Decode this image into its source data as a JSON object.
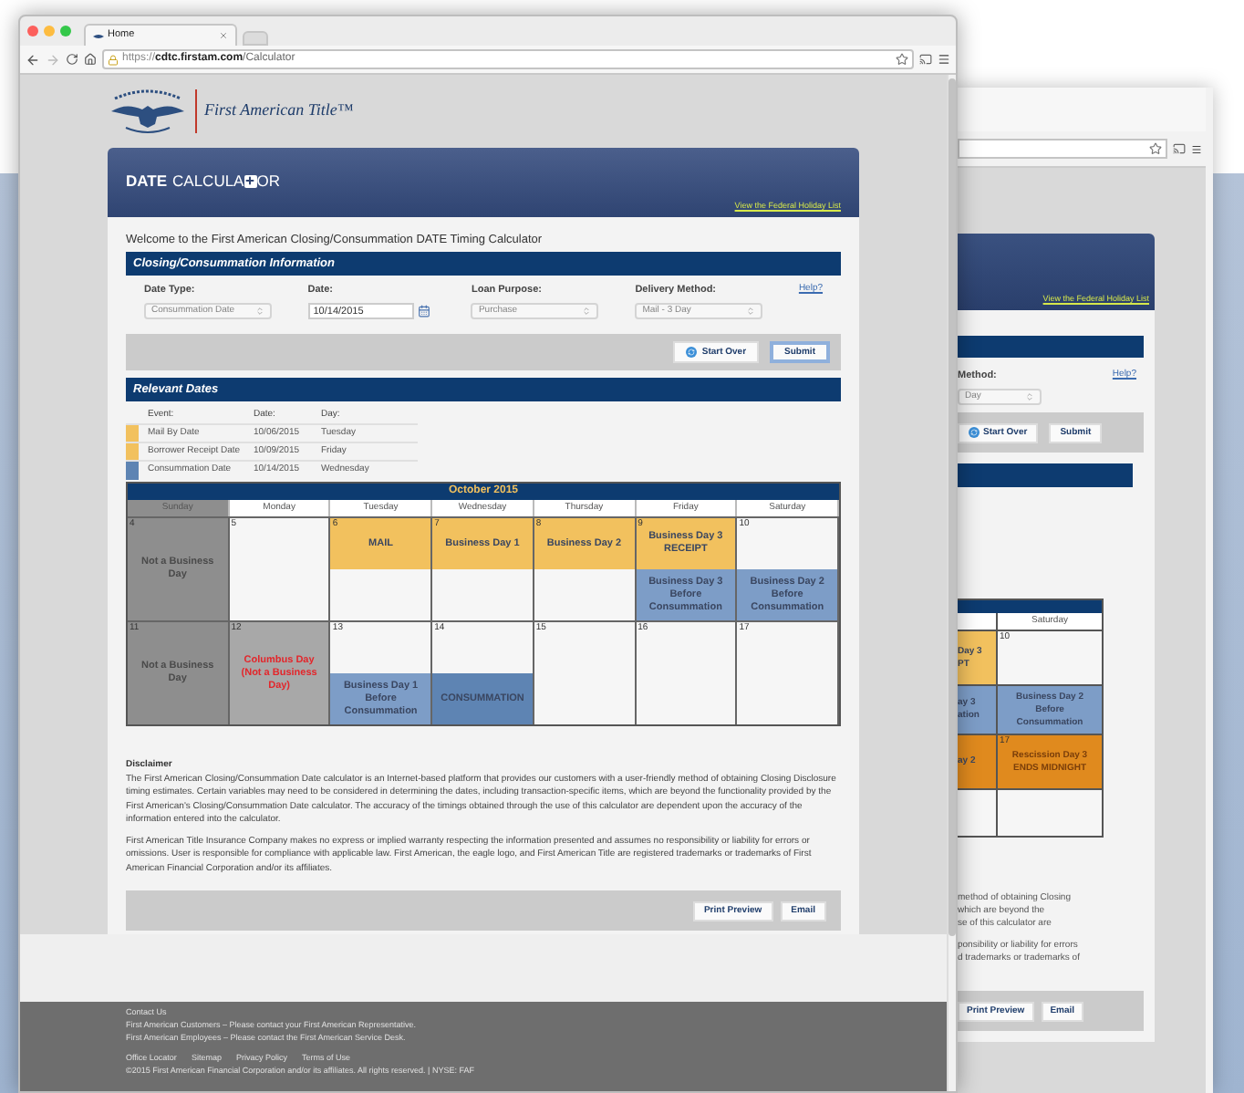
{
  "front_window": {
    "tab": {
      "title": "Home"
    },
    "address_bar": {
      "scheme": "https://",
      "host": "cdtc.firstam.com",
      "path": "/Calculator"
    },
    "logo": {
      "text": "First American Title™"
    },
    "header": {
      "title_bold": "DATE",
      "title_start": "CALCULA",
      "title_end": "OR",
      "link": "View the Federal Holiday List"
    },
    "welcome": "Welcome to the First American Closing/Consummation DATE Timing Calculator",
    "info_section": {
      "title": "Closing/Consummation Information",
      "help": "Help?",
      "fields": [
        {
          "label": "Date Type:",
          "kind": "select",
          "value": "Consummation Date",
          "disabled": true
        },
        {
          "label": "Date:",
          "kind": "date",
          "value": "10/14/2015",
          "disabled": false
        },
        {
          "label": "Loan Purpose:",
          "kind": "select",
          "value": "Purchase",
          "disabled": true
        },
        {
          "label": "Delivery Method:",
          "kind": "select",
          "value": "Mail - 3 Day",
          "disabled": true
        }
      ],
      "buttons": [
        {
          "label": "Start Over",
          "kind": "reset"
        },
        {
          "label": "Submit",
          "kind": "primary"
        }
      ]
    },
    "relevant_dates": {
      "title": "Relevant Dates",
      "columns": [
        "Event:",
        "Date:",
        "Day:"
      ],
      "rows": [
        {
          "color": "#f2c15e",
          "event": "Mail By Date",
          "date": "10/06/2015",
          "day": "Tuesday"
        },
        {
          "color": "#f2c15e",
          "event": "Borrower Receipt Date",
          "date": "10/09/2015",
          "day": "Friday"
        },
        {
          "color": "#5e84b3",
          "event": "Consummation Date",
          "date": "10/14/2015",
          "day": "Wednesday"
        }
      ]
    },
    "calendar": {
      "month": "October 2015",
      "weekdays": [
        {
          "label": "Sunday",
          "closed": true
        },
        {
          "label": "Monday",
          "closed": false
        },
        {
          "label": "Tuesday",
          "closed": false
        },
        {
          "label": "Wednesday",
          "closed": false
        },
        {
          "label": "Thursday",
          "closed": false
        },
        {
          "label": "Friday",
          "closed": false
        },
        {
          "label": "Saturday",
          "closed": false
        }
      ],
      "weeks": [
        [
          {
            "date": "4",
            "kind": "closed",
            "note": "Not a Business Day"
          },
          {
            "date": "5",
            "kind": "open"
          },
          {
            "date": "6",
            "kind": "open",
            "top_event": {
              "text": "MAIL",
              "color": "#f2c15e"
            }
          },
          {
            "date": "7",
            "kind": "open",
            "top_event": {
              "text": "Business Day 1",
              "color": "#f2c15e"
            }
          },
          {
            "date": "8",
            "kind": "open",
            "top_event": {
              "text": "Business Day 2",
              "color": "#f2c15e"
            }
          },
          {
            "date": "9",
            "kind": "open",
            "top_event": {
              "text": "Business Day 3 RECEIPT",
              "color": "#f2c15e"
            },
            "bottom_event": {
              "text": "Business Day 3 Before Consummation",
              "color": "#7d9dc7"
            }
          },
          {
            "date": "10",
            "kind": "open",
            "bottom_event": {
              "text": "Business Day 2 Before Consummation",
              "color": "#7d9dc7"
            }
          }
        ],
        [
          {
            "date": "11",
            "kind": "closed",
            "note": "Not a Business Day"
          },
          {
            "date": "12",
            "kind": "holiday",
            "note": "Columbus Day (Not a Business Day)"
          },
          {
            "date": "13",
            "kind": "open",
            "bottom_event": {
              "text": "Business Day 1 Before Consummation",
              "color": "#7d9dc7"
            }
          },
          {
            "date": "14",
            "kind": "open",
            "bottom_event": {
              "text": "CONSUMMATION",
              "color": "#5e84b3"
            }
          },
          {
            "date": "15",
            "kind": "open"
          },
          {
            "date": "16",
            "kind": "open"
          },
          {
            "date": "17",
            "kind": "open"
          }
        ]
      ]
    },
    "disclaimer": {
      "title": "Disclaimer",
      "paragraphs": [
        "The First American Closing/Consummation Date calculator is an Internet-based platform that provides our customers with a user-friendly method of obtaining Closing Disclosure timing estimates. Certain variables may need to be considered in determining the dates, including transaction-specific items, which are beyond the functionality provided by the First American's Closing/Consummation Date calculator. The accuracy of the timings obtained through the use of this calculator are dependent upon the accuracy of the information entered into the calculator.",
        "First American Title Insurance Company makes no express or implied warranty respecting the information presented and assumes no responsibility or liability for errors or omissions. User is responsible for compliance with applicable law. First American, the eagle logo, and First American Title are registered trademarks or trademarks of First American Financial Corporation and/or its affiliates."
      ]
    },
    "actions": [
      "Print Preview",
      "Email"
    ],
    "footer": {
      "contact_title": "Contact Us",
      "contact_lines": [
        "First American Customers – Please contact your First American Representative.",
        "First American Employees – Please contact the First American Service Desk."
      ],
      "links": [
        "Office Locator",
        "Sitemap",
        "Privacy Policy",
        "Terms of Use"
      ],
      "copyright": "©2015 First American Financial Corporation and/or its affiliates. All rights reserved. | NYSE: FAF"
    }
  },
  "back_window": {
    "header_link": "View the Federal Holiday List",
    "field_label": "Method:",
    "field_value": "Day",
    "help": "Help?",
    "buttons": [
      "Start Over",
      "Submit"
    ],
    "calendar": {
      "weekday": "Saturday",
      "bands": [
        {
          "cut": {
            "lines": [
              "Day 3",
              "PT"
            ],
            "color": "#f2c15e"
          },
          "saturday": {
            "date": "10"
          }
        },
        {
          "cut": {
            "lines": [
              "ay 3",
              "ation"
            ],
            "color": "#7d9dc7"
          },
          "saturday": {
            "text": "Business Day 2 Before Consummation",
            "color": "#7d9dc7"
          }
        },
        {
          "cut": {
            "lines": [
              "ay 2"
            ],
            "color": "#e08a1e"
          },
          "saturday": {
            "date": "17",
            "text": "Rescission Day 3 ENDS MIDNIGHT",
            "color": "#e08a1e"
          }
        }
      ]
    },
    "disclaimer_lines": [
      [
        "method of obtaining Closing",
        "which are beyond the",
        "se of this calculator are"
      ],
      [
        "ponsibility or liability for errors",
        "d trademarks or trademarks of"
      ]
    ],
    "actions": [
      "Print Preview",
      "Email"
    ]
  }
}
